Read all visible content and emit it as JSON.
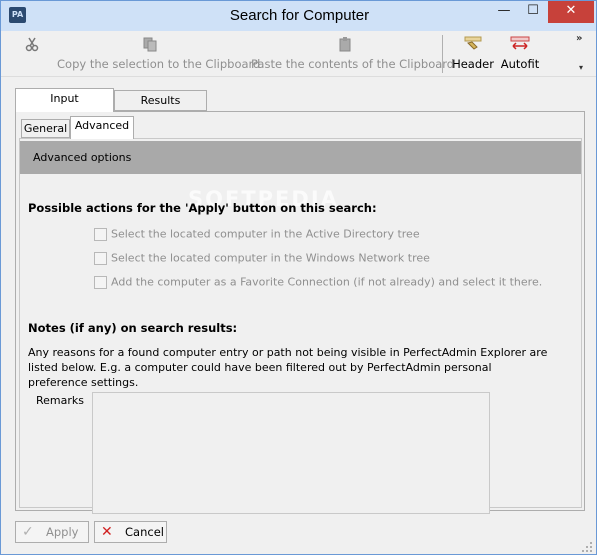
{
  "window": {
    "title": "Search for Computer",
    "app_icon": "PA"
  },
  "titlebar_buttons": {
    "minimize": "—",
    "maximize": "☐",
    "close": "✕"
  },
  "toolbar": {
    "cut_icon": "scissors-icon",
    "copy_label": "Copy the selection to the Clipboard",
    "paste_label": "Paste the contents of the Clipboard",
    "header_label": "Header",
    "autofit_label": "Autofit",
    "more": "»",
    "dropdown": "▾"
  },
  "tabs": {
    "input": "Input",
    "results": "Results"
  },
  "subtabs": {
    "general": "General",
    "advanced": "Advanced"
  },
  "advanced": {
    "header": "Advanced options",
    "watermark": "SOFTPEDIA",
    "actions_title": "Possible actions for the 'Apply' button on this search:",
    "options": [
      {
        "label": "Select the located computer in the Active Directory tree",
        "checked": false,
        "enabled": false
      },
      {
        "label": "Select the located computer in the Windows Network tree",
        "checked": false,
        "enabled": false
      },
      {
        "label": "Add the computer as a Favorite Connection (if not already) and select it there.",
        "checked": false,
        "enabled": false
      }
    ],
    "notes_title": "Notes (if any) on search results:",
    "notes_text": "Any reasons for a found computer entry or path not being visible in PerfectAdmin Explorer are listed below. E.g. a computer could have been filtered out by PerfectAdmin personal preference settings.",
    "remarks_label": "Remarks",
    "remarks_value": ""
  },
  "buttons": {
    "apply": "Apply",
    "cancel": "Cancel"
  },
  "colors": {
    "titlebar": "#cfe1f7",
    "close": "#c7413a",
    "band": "#a9a9a9"
  }
}
